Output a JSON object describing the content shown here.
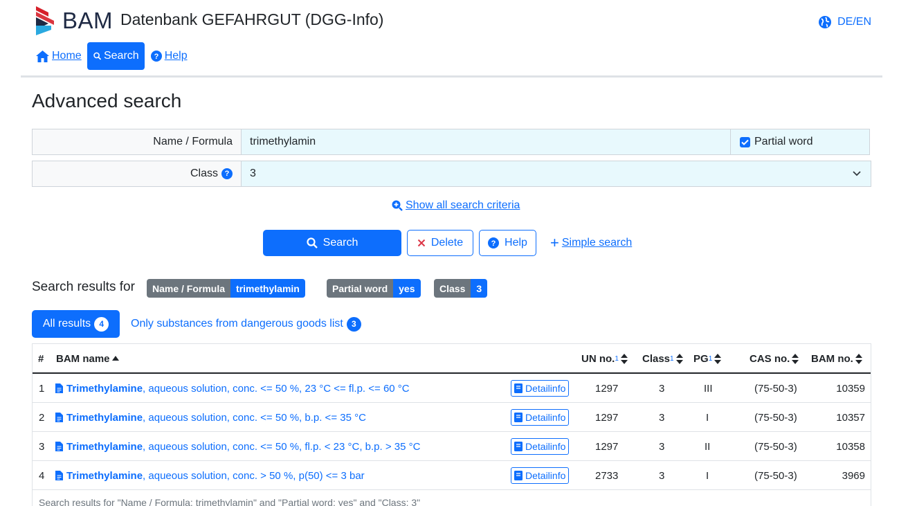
{
  "header": {
    "logo_text": "BAM",
    "app_title": "Datenbank GEFAHRGUT (DGG-Info)",
    "lang_label": "DE/EN"
  },
  "nav": {
    "home": "Home",
    "search": "Search",
    "help": "Help"
  },
  "page_title": "Advanced search",
  "form": {
    "name_label": "Name / Formula",
    "name_value": "trimethylamin",
    "partial_label": "Partial word",
    "partial_checked": true,
    "class_label": "Class",
    "class_value": "3",
    "show_all": "Show all search criteria"
  },
  "buttons": {
    "search": "Search",
    "delete": "Delete",
    "help": "Help",
    "simple": "Simple search"
  },
  "results": {
    "label": "Search results for",
    "tags": [
      {
        "key": "Name / Formula",
        "value": "trimethylamin"
      },
      {
        "key": "Partial word",
        "value": "yes"
      },
      {
        "key": "Class",
        "value": "3"
      }
    ],
    "tab_all": "All results",
    "tab_all_count": "4",
    "tab_dg": "Only substances from dangerous goods list",
    "tab_dg_count": "3"
  },
  "table": {
    "headers": {
      "index": "#",
      "name": "BAM name",
      "un": "UN no.",
      "class": "Class",
      "pg": "PG",
      "cas": "CAS no.",
      "bam": "BAM no.",
      "footnote_mark": "1"
    },
    "detail_label": "Detailinfo",
    "rows": [
      {
        "index": "1",
        "name_bold": "Trimethylamine",
        "name_rest": ", aqueous solution, conc. <= 50 %, 23 °C <= fl.p. <= 60 °C",
        "un": "1297",
        "class": "3",
        "pg": "III",
        "cas": "(75-50-3)",
        "bam": "10359"
      },
      {
        "index": "2",
        "name_bold": "Trimethylamine",
        "name_rest": ", aqueous solution, conc. <= 50 %, b.p. <= 35 °C",
        "un": "1297",
        "class": "3",
        "pg": "I",
        "cas": "(75-50-3)",
        "bam": "10357"
      },
      {
        "index": "3",
        "name_bold": "Trimethylamine",
        "name_rest": ", aqueous solution, conc. <= 50 %, fl.p. < 23 °C, b.p. > 35 °C",
        "un": "1297",
        "class": "3",
        "pg": "II",
        "cas": "(75-50-3)",
        "bam": "10358"
      },
      {
        "index": "4",
        "name_bold": "Trimethylamine",
        "name_rest": ", aqueous solution, conc. > 50 %, p(50) <= 3 bar",
        "un": "2733",
        "class": "3",
        "pg": "I",
        "cas": "(75-50-3)",
        "bam": "3969"
      }
    ],
    "footer": "Search results for \"Name / Formula: trimethylamin\" and \"Partial word: yes\" and \"Class: 3\""
  },
  "colors": {
    "primary": "#0d6efd",
    "tag_key": "#6c757d",
    "input_bg": "#e8f9fd"
  }
}
